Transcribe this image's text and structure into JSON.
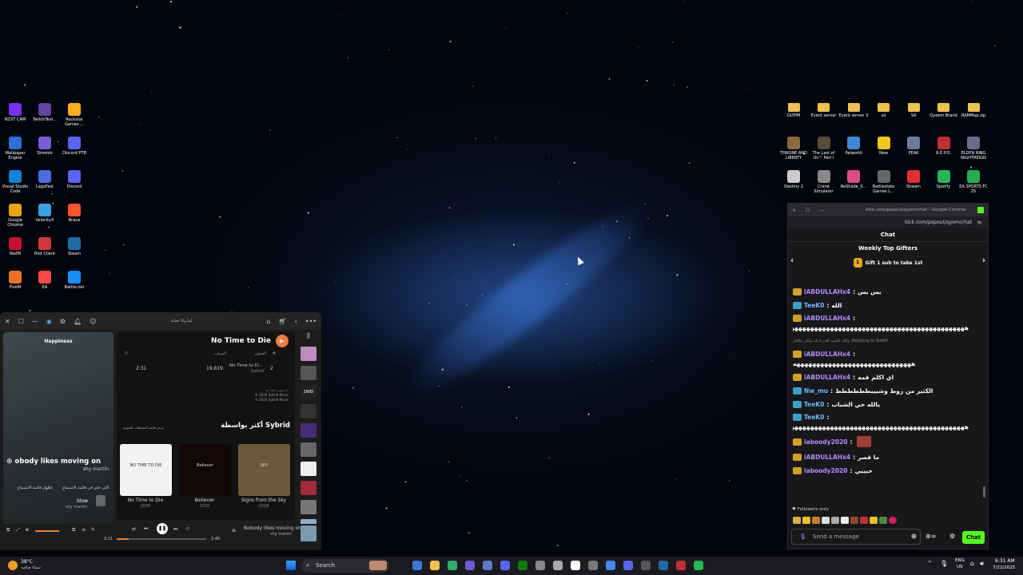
{
  "desktop": {
    "left_icons": [
      {
        "label": "NZXT CAM",
        "color": "#7b2ff7"
      },
      {
        "label": "TwitchTest...",
        "color": "#6441a5"
      },
      {
        "label": "Rockstar Games ...",
        "color": "#fcaf17"
      },
      {
        "label": "Wallpaper Engine",
        "color": "#2a6fd6"
      },
      {
        "label": "Stremio",
        "color": "#7b5bd6"
      },
      {
        "label": "Discord PTB",
        "color": "#5865f2"
      },
      {
        "label": "Visual Studio Code",
        "color": "#0a84d8"
      },
      {
        "label": "LagoFast",
        "color": "#4a6ee0"
      },
      {
        "label": "Discord",
        "color": "#5865f2"
      },
      {
        "label": "Google Chrome",
        "color": "#e8a50c"
      },
      {
        "label": "VelocityX",
        "color": "#3aa0e8"
      },
      {
        "label": "Brave",
        "color": "#fb542b"
      },
      {
        "label": "RedM",
        "color": "#c8102e"
      },
      {
        "label": "Riot Client",
        "color": "#d13639"
      },
      {
        "label": "Steam",
        "color": "#1b6ca8"
      },
      {
        "label": "FiveM",
        "color": "#f37021"
      },
      {
        "label": "EA",
        "color": "#ff4747"
      },
      {
        "label": "Battle.net",
        "color": "#148eff"
      }
    ],
    "right_icons": [
      {
        "label": "OLYPM",
        "color": "#f0c14b",
        "folder": true
      },
      {
        "label": "Event server",
        "color": "#f0c14b",
        "folder": true
      },
      {
        "label": "Event server 3",
        "color": "#f0c14b",
        "folder": true
      },
      {
        "label": "sd",
        "color": "#f0c14b",
        "folder": true
      },
      {
        "label": "S4",
        "color": "#f0c14b",
        "folder": true
      },
      {
        "label": "Qyeem Brand",
        "color": "#f0c14b",
        "folder": true
      },
      {
        "label": "RAMMap.zip",
        "color": "#f0c14b",
        "folder": true
      },
      {
        "label": "THRONE AND LIBERTY",
        "color": "#8a6a3a"
      },
      {
        "label": "The Last of Us™ Part I",
        "color": "#5a4a3a"
      },
      {
        "label": "Palworld",
        "color": "#3a8ad6"
      },
      {
        "label": "New",
        "color": "#f5c518"
      },
      {
        "label": "PEAK",
        "color": "#6a7a9a"
      },
      {
        "label": "R.E.P.O.",
        "color": "#c03030"
      },
      {
        "label": "ELDEN RING NIGHTREIGN",
        "color": "#6a6a8a"
      },
      {
        "label": "Destiny 2",
        "color": "#cccccc"
      },
      {
        "label": "Crime Simulator",
        "color": "#888888"
      },
      {
        "label": "ReShade_S...",
        "color": "#e04a8a"
      },
      {
        "label": "Battlestate Games L...",
        "color": "#666666"
      },
      {
        "label": "Stream",
        "color": "#e03030"
      },
      {
        "label": "Spotify",
        "color": "#1db954"
      },
      {
        "label": "EA SPORTS FC 25",
        "color": "#20b050"
      }
    ]
  },
  "player": {
    "top_title": "لما وانا تعبانة",
    "left_label": "Happiness",
    "now_title": "obody likes moving on",
    "now_artist": "shy martin",
    "queue_links": [
      "إظهار قائمة الاستماع",
      "اللي جاي في قائمة الاستماع"
    ],
    "next_title": "Slow",
    "next_artist": "shy martin",
    "album_title": "No Time to Die",
    "table_headers": [
      "#",
      "العنوان",
      "المرات",
      "⏱"
    ],
    "track": {
      "num": "2",
      "title": "No Time to D...",
      "artist": "Sybrid",
      "plays": "19,819",
      "time": "2:31"
    },
    "release_info": [
      "١١ رجب ١٤٤١ هـ",
      "© 2020 Sybrid Music",
      "℗ 2020 Sybrid Music"
    ],
    "more_by": "أكثر بواسطة Sybrid",
    "more_link": "عرض قائمة التسجيلات الصوتية",
    "albums": [
      {
        "title": "No Time to Die",
        "year": "2020",
        "cover": "#f2f2f2",
        "cover_text": "NO TIME TO DIE"
      },
      {
        "title": "Believer",
        "year": "2020",
        "cover": "#120606",
        "cover_text": "Believer"
      },
      {
        "title": "Signs from the Sky",
        "year": "2018",
        "cover": "#6a5a3a",
        "cover_text": "SKY"
      }
    ],
    "bar_title": "Nobody likes moving on",
    "bar_artist": "shy martin",
    "time_elapsed": "0:21",
    "time_total": "2:46",
    "progress": 0.13
  },
  "chat": {
    "window_title": "kick.com/popout/qyem/chat - Google Chrome",
    "url": "kick.com/popout/qyem/chat",
    "header": "Chat",
    "top_gifters": "Weekly Top Gifters",
    "gift_text": "Gift 1 sub to take 1st",
    "messages": [
      {
        "user": "iABDULLAHx4",
        "cls": "u1",
        "text": "بس بس"
      },
      {
        "user": "TeeK0",
        "cls": "u2",
        "text": "الله"
      },
      {
        "user": "iABDULLAHx4",
        "cls": "u1",
        "text": "ههههههههههههههههههههههههههههههههههههههههههههههههههههههه"
      },
      {
        "user": "",
        "cls": "",
        "text": "Replying to TeeK0: والله بالبيت اقدر اديله ولكن مافكر"
      },
      {
        "user": "iABDULLAHx4",
        "cls": "u1",
        "text": "ههههههههههههههههههههههههههههههه"
      },
      {
        "user": "iABDULLAHx4",
        "cls": "u1",
        "text": "اي اكلم قمه"
      },
      {
        "user": "Nw_mu",
        "cls": "u2",
        "text": "الكثير من زوط وشيييطططططط"
      },
      {
        "user": "TeeK0",
        "cls": "u2",
        "text": "يالله حي الشباب"
      },
      {
        "user": "TeeK0",
        "cls": "u2",
        "text": "ههههههههههههههههههههههههههههههههههههههههههههههههههههههههههههههههههههههههههههههههه"
      },
      {
        "user": "iaboody2020",
        "cls": "u1",
        "text": ""
      },
      {
        "user": "iABDULLAHx4",
        "cls": "u1",
        "text": "ما قصر"
      },
      {
        "user": "iaboody2020",
        "cls": "u1",
        "text": "حبيبي"
      }
    ],
    "followers_only": "Followers only",
    "input_placeholder": "Send a message",
    "send": "Chat"
  },
  "taskbar": {
    "weather_temp": "38°C",
    "weather_desc": "سماء صافية",
    "search": "Search",
    "lang": "ENG",
    "region": "US",
    "time": "6:31 AM",
    "date": "7/22/2025"
  }
}
